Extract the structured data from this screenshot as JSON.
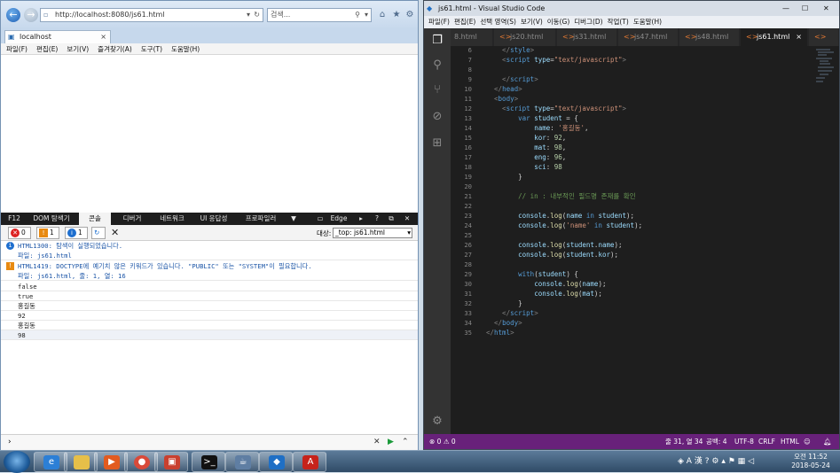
{
  "ie": {
    "address": "http://localhost:8080/js61.html",
    "search_placeholder": "검색...",
    "tab_title": "localhost",
    "menu": [
      "파일(F)",
      "편집(E)",
      "보기(V)",
      "즐겨찾기(A)",
      "도구(T)",
      "도움말(H)"
    ],
    "f12_tabs": [
      "F12",
      "DOM 탐색기",
      "콘솔",
      "디버거",
      "네트워크",
      "UI 응답성",
      "프로파일러"
    ],
    "f12_mode": "Edge",
    "counts": {
      "errors": "0",
      "warnings": "1",
      "info": "1"
    },
    "target_label": "대상:",
    "target_value": "_top: js61.html",
    "console": [
      {
        "kind": "info",
        "text": "HTML1300: 탐색이 실행되었습니다."
      },
      {
        "kind": "file",
        "text": "파일: js61.html"
      },
      {
        "kind": "warn",
        "text": "HTML1419: DOCTYPE에 예기치 않은 키워드가 있습니다. \"PUBLIC\" 또는 \"SYSTEM\"이 필요합니다."
      },
      {
        "kind": "file",
        "text": "파일: js61.html, 줄: 1, 열: 16"
      },
      {
        "kind": "log",
        "text": "false"
      },
      {
        "kind": "log",
        "text": "true"
      },
      {
        "kind": "log",
        "text": "홍길동"
      },
      {
        "kind": "log",
        "text": "92"
      },
      {
        "kind": "log",
        "text": "홍길동"
      },
      {
        "kind": "log",
        "text": "98"
      }
    ],
    "prompt": "›"
  },
  "vscode": {
    "title": "js61.html - Visual Studio Code",
    "menu": [
      "파일(F)",
      "편집(E)",
      "선택 영역(S)",
      "보기(V)",
      "이동(G)",
      "디버그(D)",
      "작업(T)",
      "도움말(H)"
    ],
    "tabs": [
      "8.html",
      "js20.html",
      "js31.html",
      "js47.html",
      "js48.html",
      "js61.html"
    ],
    "tab_close": "×",
    "line_numbers": [
      "6",
      "7",
      "8",
      "9",
      "10",
      "11",
      "12",
      "13",
      "14",
      "15",
      "16",
      "17",
      "18",
      "19",
      "20",
      "21",
      "22",
      "23",
      "24",
      "25",
      "26",
      "27",
      "28",
      "29",
      "30",
      "31",
      "32",
      "33",
      "34",
      "35"
    ],
    "status": {
      "problems": "⊗ 0 ⚠ 0",
      "position": "줄 31, 열 34",
      "spaces": "공백: 4",
      "encoding": "UTF-8",
      "eol": "CRLF",
      "language": "HTML"
    }
  },
  "taskbar": {
    "time": "오전 11:52",
    "date": "2018-05-24",
    "ime": "A 漢"
  },
  "colors": {
    "vscode_status": "#68217a",
    "editor_bg": "#1e1e1e",
    "ie_chrome": "#bcd2ea"
  }
}
